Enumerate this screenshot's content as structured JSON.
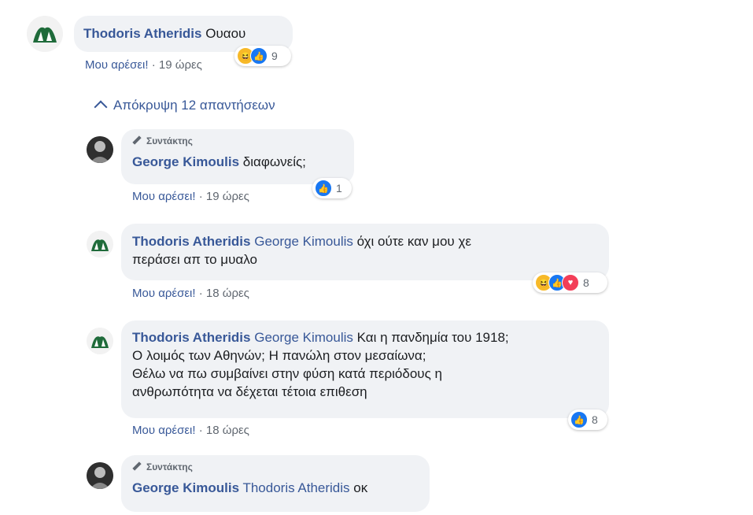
{
  "reply_toggle": {
    "label": "Απόκρυψη 12 απαντήσεων"
  },
  "editor_label": "Συντάκτης",
  "like_label": "Μου αρέσει!",
  "comments": [
    {
      "author": "Thodoris Atheridis",
      "text": "Ουαου",
      "mention": "",
      "time": "19 ώρες",
      "reaction_count": "9",
      "reactions": [
        "haha-icon",
        "like-icon"
      ]
    },
    {
      "author": "George Kimoulis",
      "text": "διαφωνείς;",
      "mention": "",
      "time": "19 ώρες",
      "reaction_count": "1",
      "reactions": [
        "like-icon"
      ],
      "badge": "Συντάκτης"
    },
    {
      "author": "Thodoris Atheridis",
      "mention": "George Kimoulis",
      "text_line1": "όχι ούτε καν μου χε",
      "text_line2": "περάσει απ το μυαλο",
      "time": "18 ώρες",
      "reaction_count": "8",
      "reactions": [
        "haha-icon",
        "like-icon",
        "love-icon"
      ]
    },
    {
      "author": "Thodoris Atheridis",
      "mention": "George Kimoulis",
      "text_line1": "Και η πανδημία του 1918;",
      "text_line2": "Ο λοιμός των Αθηνών; Η πανώλη στον μεσαίωνα;",
      "text_line3": "Θέλω να πω συμβαίνει στην φύση κατά περιόδους η",
      "text_line4": "ανθρωπότητα να δέχεται τέτοια επιθεση",
      "time": "18 ώρες",
      "reaction_count": "8",
      "reactions": [
        "like-icon"
      ]
    },
    {
      "author": "George Kimoulis",
      "mention": "Thodoris Atheridis",
      "text": "οκ",
      "badge": "Συντάκτης"
    }
  ],
  "colors": {
    "link": "#385898",
    "bubble": "#f0f2f5",
    "meta": "#606770",
    "like": "#1877f2",
    "haha": "#f7b928",
    "love": "#f33e58"
  }
}
